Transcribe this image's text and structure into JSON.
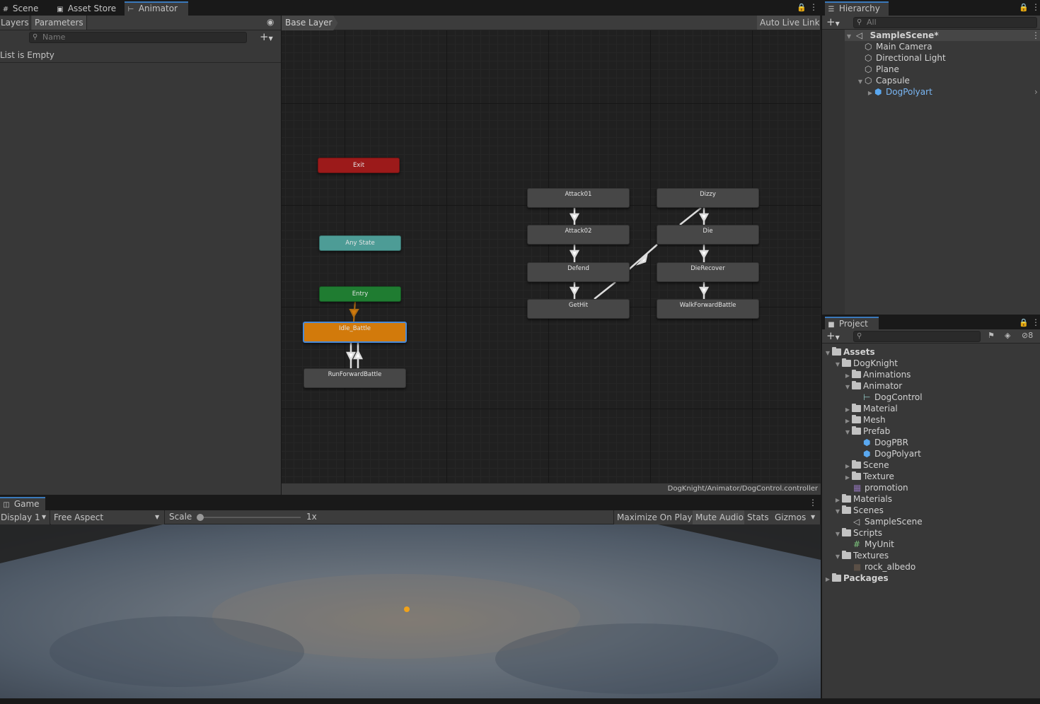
{
  "top_tabs": {
    "scene": "Scene",
    "asset_store": "Asset Store",
    "animator": "Animator"
  },
  "animator": {
    "layers_tab": "Layers",
    "parameters_tab": "Parameters",
    "search_placeholder": "Name",
    "empty_text": "List is Empty",
    "breadcrumb": "Base Layer",
    "auto_live_link": "Auto Live Link",
    "footer_path": "DogKnight/Animator/DogControl.controller",
    "nodes": {
      "exit": "Exit",
      "any_state": "Any State",
      "entry": "Entry",
      "idle_battle": "Idle_Battle",
      "run_forward": "RunForwardBattle",
      "attack01": "Attack01",
      "attack02": "Attack02",
      "defend": "Defend",
      "gethit": "GetHit",
      "dizzy": "Dizzy",
      "die": "Die",
      "die_recover": "DieRecover",
      "walk_forward": "WalkForwardBattle"
    }
  },
  "hierarchy": {
    "title": "Hierarchy",
    "search_placeholder": "All",
    "scene": "SampleScene*",
    "items": [
      "Main Camera",
      "Directional Light",
      "Plane",
      "Capsule",
      "DogPolyart"
    ]
  },
  "project": {
    "title": "Project",
    "badge": "8",
    "tree": {
      "assets": "Assets",
      "dogknight": "DogKnight",
      "animations": "Animations",
      "animator": "Animator",
      "dogcontrol": "DogControl",
      "material": "Material",
      "mesh": "Mesh",
      "prefab": "Prefab",
      "dogpbr": "DogPBR",
      "dogpolyart": "DogPolyart",
      "scene": "Scene",
      "texture": "Texture",
      "promotion": "promotion",
      "materials": "Materials",
      "scenes": "Scenes",
      "samplescene": "SampleScene",
      "scripts": "Scripts",
      "myunit": "MyUnit",
      "textures": "Textures",
      "rock_albedo": "rock_albedo",
      "packages": "Packages"
    }
  },
  "game": {
    "tab": "Game",
    "display": "Display 1",
    "aspect": "Free Aspect",
    "scale_label": "Scale",
    "scale_value": "1x",
    "maximize": "Maximize On Play",
    "mute": "Mute Audio",
    "stats": "Stats",
    "gizmos": "Gizmos"
  },
  "colors": {
    "selection": "#3a79bb",
    "exit": "#9c1a1a",
    "any_state": "#4d9c96",
    "entry": "#1f7c31",
    "default_state": "#d27a0b",
    "prefab_blue": "#5aa8f0"
  }
}
